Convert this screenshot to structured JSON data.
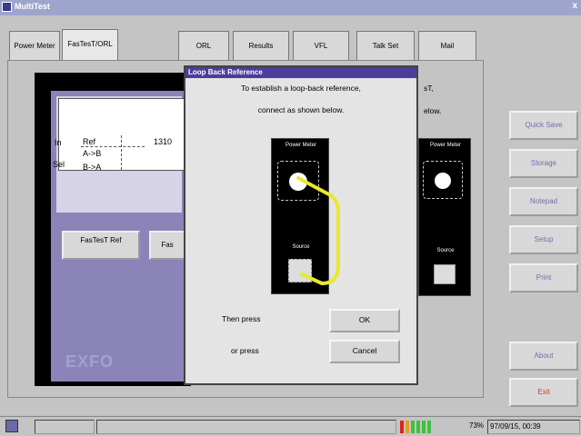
{
  "window": {
    "title": "MultiTest"
  },
  "tabs": [
    {
      "label": "Power Meter"
    },
    {
      "label": "FasTesT/ORL"
    },
    {
      "label": "ORL"
    },
    {
      "label": "Results"
    },
    {
      "label": "VFL"
    },
    {
      "label": "Talk Set"
    },
    {
      "label": "Mail"
    }
  ],
  "background_panel": {
    "ref_label": "Ref",
    "ref_value": "1310",
    "ab_label": "A->B",
    "ba_label": "B->A",
    "in_label": "In",
    "sel_label": "Sel",
    "fastest_ref_button": "FasTesT Ref",
    "second_button": "Fas",
    "logo": "EXFO",
    "partial_text_1": "sT,",
    "partial_text_2": "elow."
  },
  "sidebar": {
    "buttons": [
      {
        "label": "Quick Save"
      },
      {
        "label": "Storage"
      },
      {
        "label": "Notepad"
      },
      {
        "label": "Setup"
      },
      {
        "label": "Print"
      },
      {
        "label": "About"
      },
      {
        "label": "Exit"
      }
    ]
  },
  "dialog": {
    "title": "Loop Back Reference",
    "line1": "To establish a loop-back reference,",
    "line2": "connect as shown below.",
    "device_left": {
      "top_label": "Power Meter",
      "bottom_label": "Source"
    },
    "device_right": {
      "top_label": "Power Meter",
      "bottom_label": "Source"
    },
    "then_press": "Then press",
    "or_press": "or press",
    "ok_label": "OK",
    "cancel_label": "Cancel",
    "cable_color": "#e8e830"
  },
  "statusbar": {
    "battery_percent": "73%",
    "datetime": "97/09/15, 00:39"
  }
}
